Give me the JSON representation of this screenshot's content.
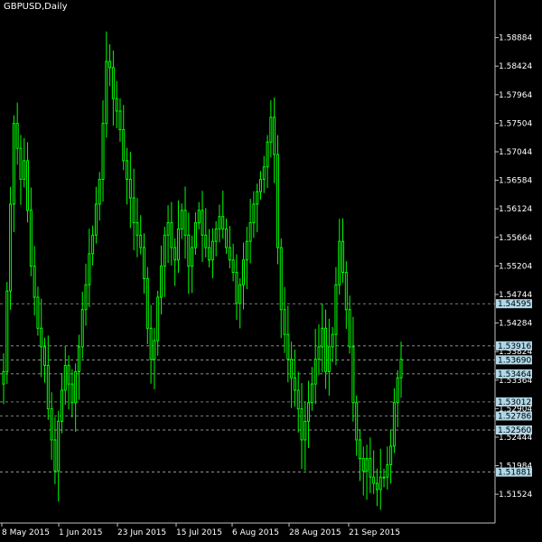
{
  "window": {
    "symbol_label": "GBPUSD,Daily"
  },
  "colors": {
    "background": "#000000",
    "candle": "#00ff00",
    "grid": "#c0c0c0",
    "axis": "#c0c0c0",
    "label_bg": "#b0d8e8"
  },
  "price_axis": {
    "labels": [
      "1.58884",
      "1.58424",
      "1.57964",
      "1.57504",
      "1.57044",
      "1.56584",
      "1.56124",
      "1.55664",
      "1.55204",
      "1.54744",
      "1.54284",
      "1.53824",
      "1.53364",
      "1.52904",
      "1.52444",
      "1.51984",
      "1.51524"
    ]
  },
  "time_axis": {
    "labels": [
      "8 May 2015",
      "1 Jun 2015",
      "23 Jun 2015",
      "15 Jul 2015",
      "6 Aug 2015",
      "28 Aug 2015",
      "21 Sep 2015"
    ]
  },
  "horizontal_levels": [
    "1.54595",
    "1.53916",
    "1.53690",
    "1.53464",
    "1.53012",
    "1.52786",
    "1.52560",
    "1.51881"
  ],
  "chart_data": {
    "type": "candlestick",
    "title": "GBPUSD,Daily",
    "ylim": [
      1.5106,
      1.5949
    ],
    "x_tick_labels": [
      "8 May 2015",
      "1 Jun 2015",
      "23 Jun 2015",
      "15 Jul 2015",
      "6 Aug 2015",
      "28 Aug 2015",
      "21 Sep 2015"
    ],
    "y_tick_labels": [
      "1.58884",
      "1.58424",
      "1.57964",
      "1.57504",
      "1.57044",
      "1.56584",
      "1.56124",
      "1.55664",
      "1.55204",
      "1.54744",
      "1.54284",
      "1.53824",
      "1.53364",
      "1.52904",
      "1.52444",
      "1.51984",
      "1.51524"
    ],
    "close_series": [
      1.535,
      1.548,
      1.562,
      1.575,
      1.571,
      1.566,
      1.569,
      1.561,
      1.552,
      1.547,
      1.542,
      1.539,
      1.536,
      1.529,
      1.524,
      1.519,
      1.527,
      1.532,
      1.536,
      1.533,
      1.53,
      1.535,
      1.539,
      1.545,
      1.549,
      1.554,
      1.557,
      1.562,
      1.566,
      1.575,
      1.585,
      1.584,
      1.579,
      1.577,
      1.574,
      1.569,
      1.566,
      1.563,
      1.559,
      1.557,
      1.555,
      1.55,
      1.542,
      1.537,
      1.54,
      1.547,
      1.552,
      1.557,
      1.559,
      1.555,
      1.553,
      1.558,
      1.561,
      1.557,
      1.552,
      1.555,
      1.559,
      1.561,
      1.557,
      1.555,
      1.553,
      1.556,
      1.558,
      1.56,
      1.558,
      1.555,
      1.553,
      1.551,
      1.546,
      1.549,
      1.553,
      1.556,
      1.559,
      1.562,
      1.564,
      1.566,
      1.568,
      1.572,
      1.576,
      1.57,
      1.555,
      1.545,
      1.541,
      1.537,
      1.534,
      1.532,
      1.529,
      1.524,
      1.527,
      1.53,
      1.533,
      1.537,
      1.539,
      1.542,
      1.535,
      1.539,
      1.541,
      1.549,
      1.556,
      1.551,
      1.545,
      1.539,
      1.53,
      1.524,
      1.521,
      1.519,
      1.521,
      1.518,
      1.517,
      1.516,
      1.518,
      1.518,
      1.52,
      1.523,
      1.53,
      1.534,
      1.537
    ]
  }
}
